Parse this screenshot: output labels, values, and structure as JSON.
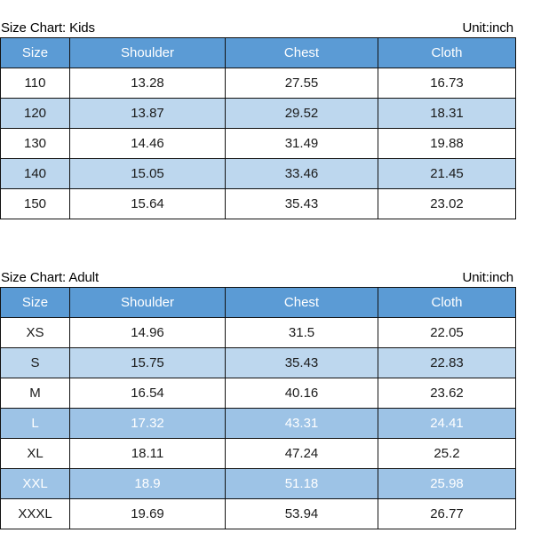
{
  "unit_label": "Unit:inch",
  "colors": {
    "header_bg": "#5B9BD5",
    "header_text": "#FFFFFF",
    "row_plain_bg": "#FFFFFF",
    "row_highlight_light_bg": "#BDD7EE",
    "row_highlight_deep_bg": "#9DC3E6",
    "row_highlight_deep_text": "#FFFFFF",
    "border": "#111111",
    "text": "#1A1A1A"
  },
  "tables": [
    {
      "caption": "Size Chart: Kids",
      "unit": "Unit:inch",
      "columns": [
        "Size",
        "Shoulder",
        "Chest",
        "Cloth"
      ],
      "rows": [
        {
          "style": "plain",
          "cells": [
            "110",
            "13.28",
            "27.55",
            "16.73"
          ]
        },
        {
          "style": "light",
          "cells": [
            "120",
            "13.87",
            "29.52",
            "18.31"
          ]
        },
        {
          "style": "plain",
          "cells": [
            "130",
            "14.46",
            "31.49",
            "19.88"
          ]
        },
        {
          "style": "light",
          "cells": [
            "140",
            "15.05",
            "33.46",
            "21.45"
          ]
        },
        {
          "style": "plain",
          "cells": [
            "150",
            "15.64",
            "35.43",
            "23.02"
          ]
        }
      ]
    },
    {
      "caption": "Size Chart: Adult",
      "unit": "Unit:inch",
      "columns": [
        "Size",
        "Shoulder",
        "Chest",
        "Cloth"
      ],
      "rows": [
        {
          "style": "plain",
          "cells": [
            "XS",
            "14.96",
            "31.5",
            "22.05"
          ]
        },
        {
          "style": "light",
          "cells": [
            "S",
            "15.75",
            "35.43",
            "22.83"
          ]
        },
        {
          "style": "plain",
          "cells": [
            "M",
            "16.54",
            "40.16",
            "23.62"
          ]
        },
        {
          "style": "deep",
          "cells": [
            "L",
            "17.32",
            "43.31",
            "24.41"
          ]
        },
        {
          "style": "plain",
          "cells": [
            "XL",
            "18.11",
            "47.24",
            "25.2"
          ]
        },
        {
          "style": "deep",
          "cells": [
            "XXL",
            "18.9",
            "51.18",
            "25.98"
          ]
        },
        {
          "style": "plain",
          "cells": [
            "XXXL",
            "19.69",
            "53.94",
            "26.77"
          ]
        }
      ]
    }
  ],
  "chart_data": {
    "type": "table",
    "title": "Garment Size Charts (Kids and Adult)",
    "unit": "inch",
    "tables": [
      {
        "name": "Size Chart: Kids",
        "columns": [
          "Size",
          "Shoulder",
          "Chest",
          "Cloth"
        ],
        "categories": [
          "110",
          "120",
          "130",
          "140",
          "150"
        ],
        "series": [
          {
            "name": "Shoulder",
            "values": [
              13.28,
              13.87,
              14.46,
              15.05,
              15.64
            ]
          },
          {
            "name": "Chest",
            "values": [
              27.55,
              29.52,
              31.49,
              33.46,
              35.43
            ]
          },
          {
            "name": "Cloth",
            "values": [
              16.73,
              18.31,
              19.88,
              21.45,
              23.02
            ]
          }
        ]
      },
      {
        "name": "Size Chart: Adult",
        "columns": [
          "Size",
          "Shoulder",
          "Chest",
          "Cloth"
        ],
        "categories": [
          "XS",
          "S",
          "M",
          "L",
          "XL",
          "XXL",
          "XXXL"
        ],
        "series": [
          {
            "name": "Shoulder",
            "values": [
              14.96,
              15.75,
              16.54,
              17.32,
              18.11,
              18.9,
              19.69
            ]
          },
          {
            "name": "Chest",
            "values": [
              31.5,
              35.43,
              40.16,
              43.31,
              47.24,
              51.18,
              53.94
            ]
          },
          {
            "name": "Cloth",
            "values": [
              22.05,
              22.83,
              23.62,
              24.41,
              25.2,
              25.98,
              26.77
            ]
          }
        ]
      }
    ]
  }
}
